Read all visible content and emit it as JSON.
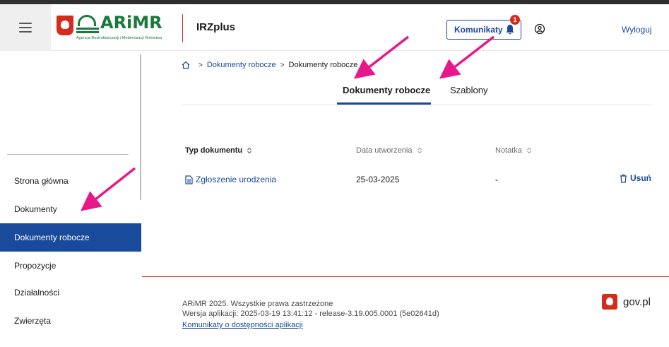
{
  "header": {
    "logo_text": "ARiMR",
    "logo_subtitle": "Agencja Restrukturyzacji i Modernizacji Rolnictwa",
    "app_name": "IRZplus",
    "notifications_label": "Komunikaty",
    "notifications_count": "1",
    "logout_label": "Wyloguj"
  },
  "sidebar": {
    "items": [
      {
        "label": "Strona główna",
        "active": false
      },
      {
        "label": "Dokumenty",
        "active": false
      },
      {
        "label": "Dokumenty robocze",
        "active": true
      },
      {
        "label": "Propozycje",
        "active": false
      },
      {
        "label": "Działalności",
        "active": false
      },
      {
        "label": "Zwierzęta",
        "active": false
      }
    ]
  },
  "breadcrumb": {
    "link": "Dokumenty robocze",
    "current": "Dokumenty robocze",
    "separator": ">"
  },
  "tabs": [
    {
      "label": "Dokumenty robocze",
      "active": true
    },
    {
      "label": "Szablony",
      "active": false
    }
  ],
  "table": {
    "columns": [
      "Typ dokumentu",
      "Data utworzenia",
      "Notatka"
    ],
    "rows": [
      {
        "type": "Zgłoszenie urodzenia",
        "date": "25-03-2025",
        "note": "-",
        "action": "Usuń"
      }
    ]
  },
  "footer": {
    "copyright": "ARiMR 2025. Wszystkie prawa zastrzeżone",
    "version": "Wersja aplikacji: 2025-03-19 13:41:12 - release-3.19.005.0001 (5e02641d)",
    "accessibility_link": "Komunikaty o dostępności aplikacji",
    "gov_label": "gov.pl"
  },
  "colors": {
    "primary": "#1a4a9c",
    "accent_red": "#d52b1e",
    "brand_green": "#1a7a3a",
    "annotation_pink": "#e8178a"
  }
}
